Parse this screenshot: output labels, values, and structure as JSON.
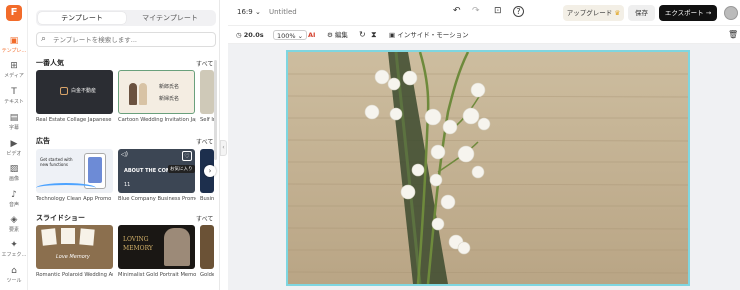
{
  "rail": {
    "items": [
      {
        "label": "テンプレ…",
        "icon": "template-icon"
      },
      {
        "label": "メディア",
        "icon": "media-icon"
      },
      {
        "label": "テキスト",
        "icon": "text-icon"
      },
      {
        "label": "字幕",
        "icon": "subtitle-icon"
      },
      {
        "label": "ビデオ",
        "icon": "video-icon"
      },
      {
        "label": "画像",
        "icon": "image-icon"
      },
      {
        "label": "音声",
        "icon": "audio-icon"
      },
      {
        "label": "要素",
        "icon": "elements-icon"
      },
      {
        "label": "エフェク…",
        "icon": "effects-icon"
      },
      {
        "label": "ツール",
        "icon": "tools-icon"
      }
    ]
  },
  "panel": {
    "tab_templates": "テンプレート",
    "tab_my_templates": "マイテンプレート",
    "search_placeholder": "テンプレートを検索します...",
    "see_all": "すべて",
    "sections": [
      {
        "title": "一番人気",
        "items": [
          "Real Estate Collage Japanese",
          "Cartoon Wedding Invitation Japa...",
          "Self In"
        ]
      },
      {
        "title": "広告",
        "items": [
          "Technology Clean App Promo",
          "Blue Company Business Promo ...",
          "Busine"
        ]
      },
      {
        "title": "スライドショー",
        "items": [
          "Romantic Polaroid Wedding Anni...",
          "Minimalist Gold Portrait Memorial",
          "Golder"
        ]
      }
    ],
    "thumb_texts": {
      "realestate": "白金不動産",
      "wedding1": "新郎氏名",
      "wedding2": "新婦氏名",
      "tech": "Get started with new functions",
      "company_tag": "お気に入り",
      "company_title": "ABOUT THE COMPANY",
      "company_year": "11",
      "love": "Love Memory",
      "memory1": "LOVING",
      "memory2": "MEMORY"
    }
  },
  "topbar": {
    "ratio": "16:9",
    "title": "Untitled",
    "upgrade": "アップグレード",
    "save": "保存",
    "export": "エクスポート"
  },
  "toolbar": {
    "duration": "20.0s",
    "zoom": "100%",
    "edit": "編集",
    "inside_motion": "インサイド・モーション"
  }
}
